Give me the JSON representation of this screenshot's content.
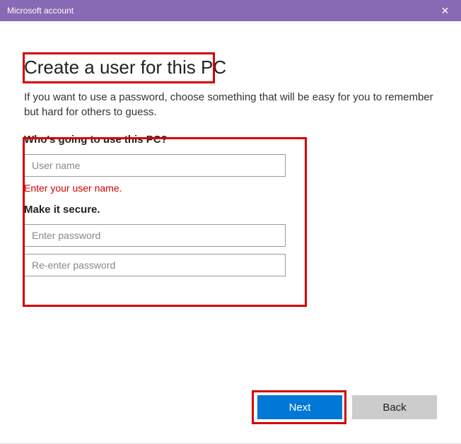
{
  "titlebar": {
    "title": "Microsoft account",
    "close_label": "✕"
  },
  "main": {
    "heading": "Create a user for this PC",
    "subtext": "If you want to use a password, choose something that will be easy for you to remember but hard for others to guess.",
    "section_user_label": "Who's going to use this PC?",
    "username_placeholder": "User name",
    "username_value": "",
    "error_username": "Enter your user name.",
    "section_secure_label": "Make it secure.",
    "password_placeholder": "Enter password",
    "password_value": "",
    "password2_placeholder": "Re-enter password",
    "password2_value": ""
  },
  "buttons": {
    "next": "Next",
    "back": "Back"
  }
}
